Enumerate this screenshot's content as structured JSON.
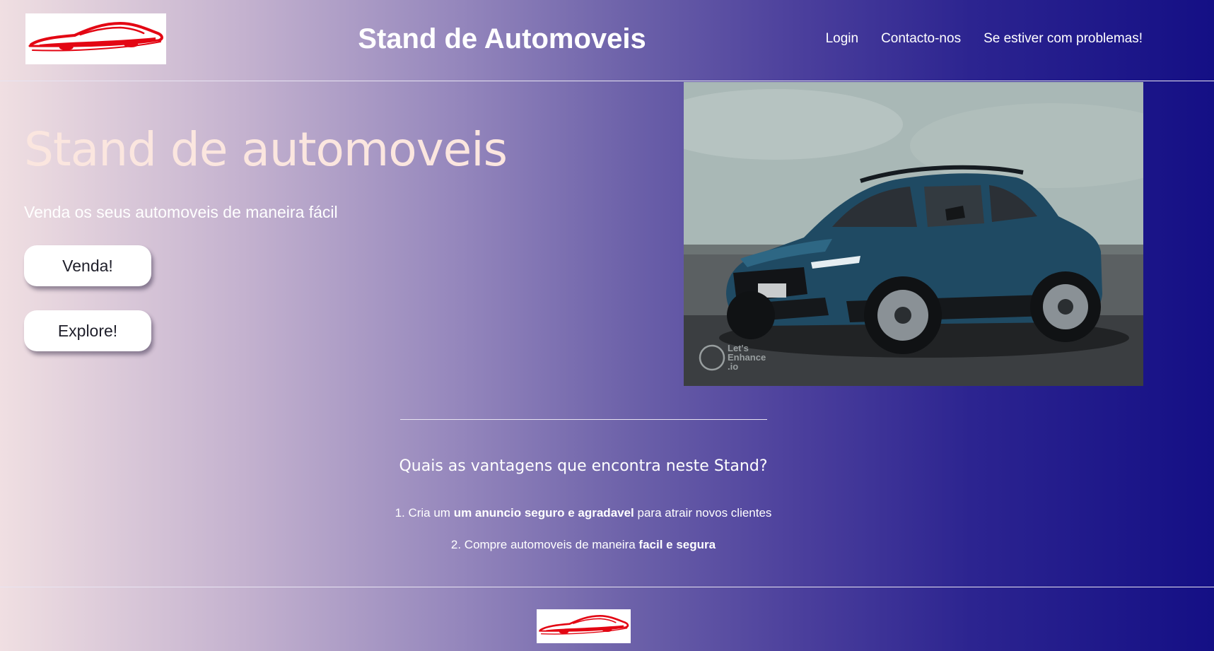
{
  "header": {
    "title": "Stand de Automoveis",
    "logo_icon": "car-silhouette-logo",
    "nav": [
      {
        "label": "Login"
      },
      {
        "label": "Contacto-nos"
      },
      {
        "label": "Se estiver com problemas!"
      }
    ]
  },
  "hero": {
    "title": "Stand de automoveis",
    "subtitle": "Venda os seus automoveis de maneira fácil",
    "buttons": [
      {
        "label": "Venda!"
      },
      {
        "label": "Explore!"
      }
    ],
    "image": {
      "description_icon": "suv-car-photo",
      "watermark_lines": [
        "Let's",
        "Enhance",
        ".io"
      ]
    }
  },
  "advantages": {
    "title": "Quais as vantagens que encontra neste Stand?",
    "items": [
      {
        "prefix": "1. Cria um ",
        "bold": "um anuncio seguro e agradavel",
        "suffix": " para atrair novos clientes"
      },
      {
        "prefix": "2. Compre automoveis de maneira ",
        "bold": "facil e segura",
        "suffix": ""
      }
    ]
  },
  "footer": {
    "logo_icon": "car-silhouette-logo"
  },
  "colors": {
    "gradient_start": "#f0dfe2",
    "gradient_end": "#140f85",
    "hero_title": "#fbe6df",
    "logo_red": "#e30613",
    "button_bg": "#ffffff"
  }
}
